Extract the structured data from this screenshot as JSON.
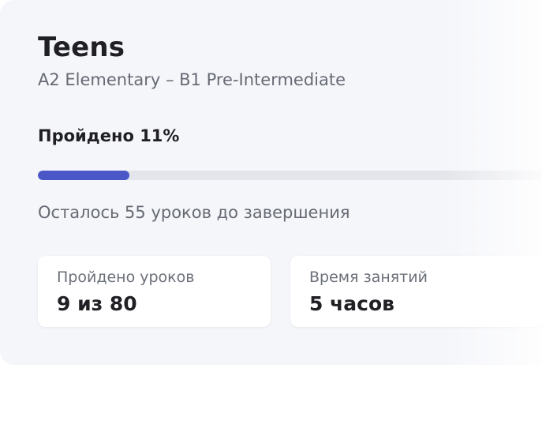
{
  "course": {
    "title": "Teens",
    "level_range": "A2 Elementary – B1 Pre-Intermediate"
  },
  "progress": {
    "label": "Пройдено 11%",
    "fraction": 0.176,
    "remaining_text": "Осталось 55 уроков до завершения"
  },
  "stats": [
    {
      "label": "Пройдено уроков",
      "value": "9 из 80"
    },
    {
      "label": "Время занятий",
      "value": "5 часов"
    }
  ],
  "colors": {
    "accent": "#4b57c7",
    "card_bg": "#f5f6fa",
    "track": "#e4e5ea"
  }
}
